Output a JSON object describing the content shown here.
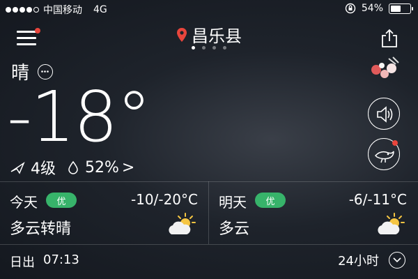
{
  "statusbar": {
    "carrier": "中国移动",
    "network": "4G",
    "battery": "54%",
    "battery_level": 0.54,
    "signal_bars": 4
  },
  "header": {
    "city": "昌乐县",
    "page_count": 4,
    "active_page": 1
  },
  "current": {
    "condition": "晴",
    "temperature": "-18°",
    "wind": "4级",
    "humidity": "52%",
    "more": ">"
  },
  "forecast": [
    {
      "day": "今天",
      "quality": "优",
      "temp": "-10/-20°C",
      "condition": "多云转晴",
      "icon": "partly-sunny-icon"
    },
    {
      "day": "明天",
      "quality": "优",
      "temp": "-6/-11°C",
      "condition": "多云",
      "icon": "partly-sunny-icon"
    }
  ],
  "footer": {
    "sunrise_label": "日出",
    "sunrise_time": "07:13",
    "hours_label": "24小时"
  },
  "colors": {
    "badge_red": "#e8453c",
    "quality_green": "#37b36a",
    "location_pin": "#e8453c",
    "sun": "#f5c542"
  }
}
